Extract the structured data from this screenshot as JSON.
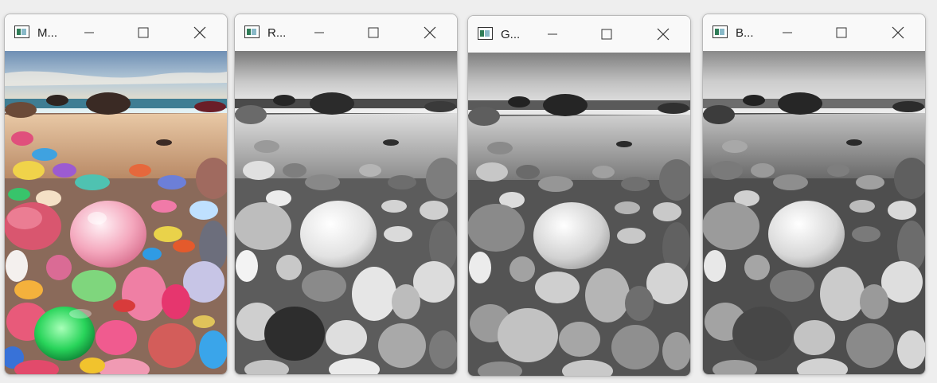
{
  "windows": [
    {
      "title": "M...",
      "mode": "color"
    },
    {
      "title": "R...",
      "mode": "gray"
    },
    {
      "title": "G...",
      "mode": "gray"
    },
    {
      "title": "B...",
      "mode": "gray"
    }
  ],
  "controls": {
    "minimize_icon": "minimize-icon",
    "maximize_icon": "maximize-icon",
    "close_icon": "close-icon"
  }
}
